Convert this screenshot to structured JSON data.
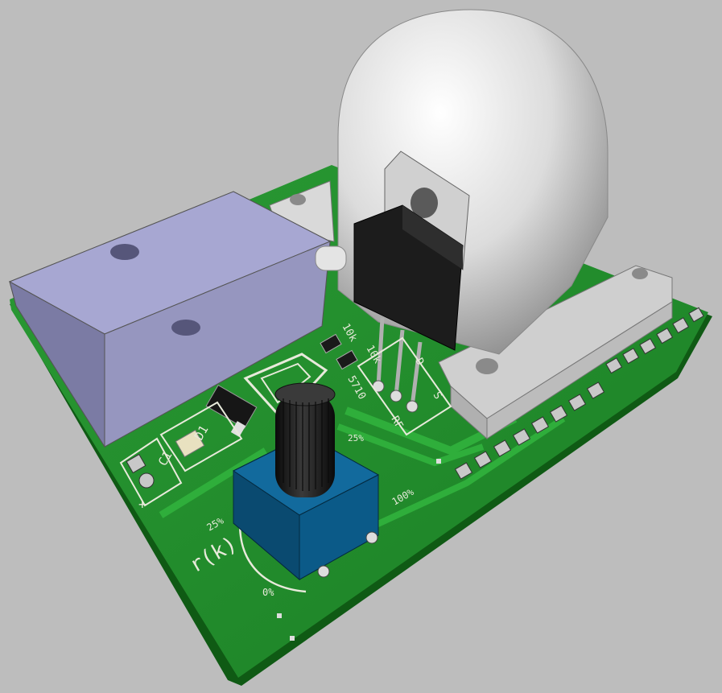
{
  "colors": {
    "background": "#bdbdbd",
    "pcb_green": "#1f8a2a",
    "pcb_edge": "#0f5a14",
    "silkscreen": "#e8eadb",
    "relay_body": "#9a9ac2",
    "heatsink_body": "#d6d6d6",
    "dome": "#e0e0e0",
    "transistor_body": "#1c1c1c",
    "pot_base": "#0e5a86",
    "pot_shaft": "#1e1e1e"
  },
  "silkscreen": {
    "c1": "C1",
    "d1": "D1",
    "plus": "+",
    "r_k": "r(k)",
    "pct_0": "0%",
    "pct_25": "25%",
    "pct_25b": "25%",
    "pct_100": "100%",
    "val_5710": "5710",
    "val_10k": "10k",
    "val_10k_b": "10k",
    "pin_s": "S",
    "pin_d": "D",
    "pin_rf": "RF"
  }
}
